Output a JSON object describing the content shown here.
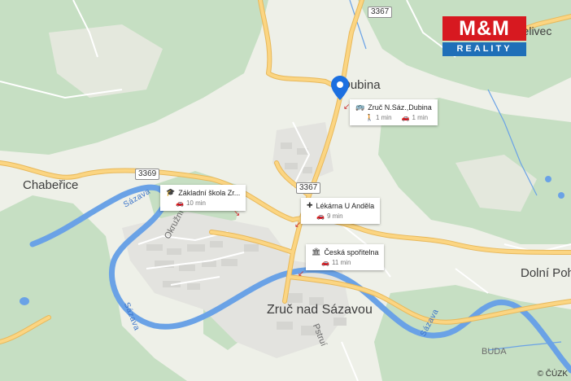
{
  "logo": {
    "brand": "M&M",
    "tagline": "REALITY"
  },
  "places": {
    "dubina": "Dubina",
    "chaberice": "Chabeřice",
    "zruc": "Zruč nad Sázavou",
    "dolni_poh": "Dolní Poh",
    "zelivec": "Želivec"
  },
  "streets": {
    "okruzni": "Okružní",
    "pstrui": "Pstruí",
    "buda": "BUDA"
  },
  "river": {
    "sazava": "Sázava"
  },
  "road_numbers": {
    "r3367_top": "3367",
    "r3369": "3369",
    "r3367_mid": "3367"
  },
  "pois": [
    {
      "icon": "bus-icon",
      "name": "Zruč N.Sáz.,Dubina",
      "walk": "1 min",
      "drive": "1 min"
    },
    {
      "icon": "school-icon",
      "name": "Základní škola Zr...",
      "drive": "10 min"
    },
    {
      "icon": "pharmacy-icon",
      "name": "Lékárna U Anděla",
      "drive": "9 min"
    },
    {
      "icon": "bank-icon",
      "name": "Česká spořitelna",
      "drive": "11 min"
    }
  ],
  "copyright": "© ČÚZK",
  "colors": {
    "water": "#6aa2e6",
    "road": "#fbd582",
    "road_edge": "#e8b85a",
    "forest": "#c6dfc3",
    "land": "#eef0e8",
    "marker": "#1c6fe0"
  }
}
